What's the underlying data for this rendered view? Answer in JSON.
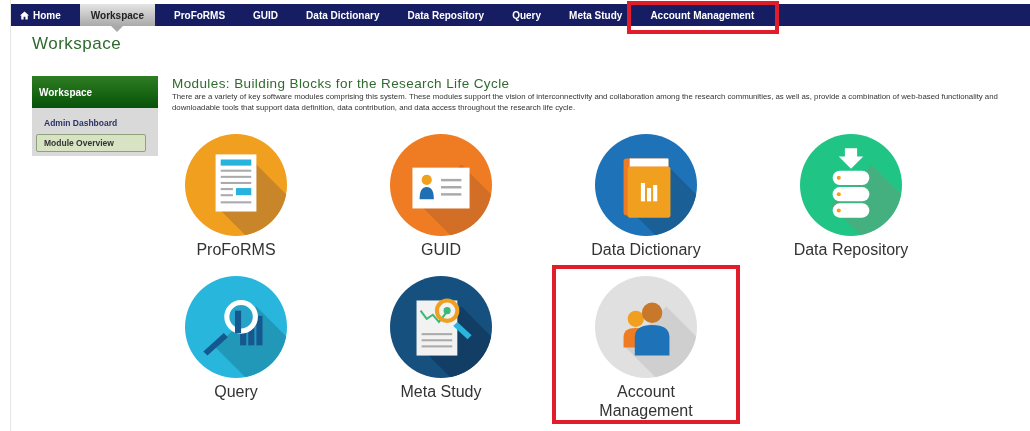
{
  "nav": [
    {
      "label": "Home",
      "kind": "home",
      "selected": false,
      "highlighted": false
    },
    {
      "label": "Workspace",
      "kind": "link",
      "selected": true,
      "highlighted": false
    },
    {
      "label": "ProFoRMS",
      "kind": "link",
      "selected": false,
      "highlighted": false
    },
    {
      "label": "GUID",
      "kind": "link",
      "selected": false,
      "highlighted": false
    },
    {
      "label": "Data Dictionary",
      "kind": "link",
      "selected": false,
      "highlighted": false
    },
    {
      "label": "Data Repository",
      "kind": "link",
      "selected": false,
      "highlighted": false
    },
    {
      "label": "Query",
      "kind": "link",
      "selected": false,
      "highlighted": false
    },
    {
      "label": "Meta Study",
      "kind": "link",
      "selected": false,
      "highlighted": false
    },
    {
      "label": "Account Management",
      "kind": "link",
      "selected": false,
      "highlighted": true
    }
  ],
  "page_title": "Workspace",
  "sidebar": {
    "header": "Workspace",
    "items": [
      {
        "label": "Admin Dashboard",
        "selected": false
      },
      {
        "label": "Module Overview",
        "selected": true
      }
    ]
  },
  "content": {
    "heading": "Modules: Building Blocks for the Research Life Cycle",
    "description": "There are a variety of key software modules comprising this system. These modules support the vision of interconnectivity and collaboration among the research communities, as well as, provide a combination of web-based functionality and downloadable tools that support data definition, data contribution, and data access throughout the research life cycle.",
    "modules": [
      {
        "label": "ProFoRMS",
        "kind": "forms",
        "highlighted": false
      },
      {
        "label": "GUID",
        "kind": "guid",
        "highlighted": false
      },
      {
        "label": "Data Dictionary",
        "kind": "dictionary",
        "highlighted": false
      },
      {
        "label": "Data Repository",
        "kind": "repository",
        "highlighted": false
      },
      {
        "label": "Query",
        "kind": "query",
        "highlighted": false
      },
      {
        "label": "Meta Study",
        "kind": "meta",
        "highlighted": false
      },
      {
        "label": "Account Management",
        "kind": "account",
        "highlighted": true
      }
    ]
  }
}
